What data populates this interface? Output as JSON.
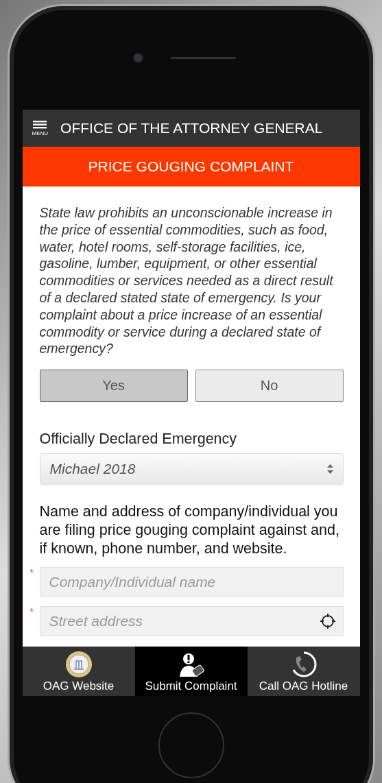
{
  "header": {
    "menu_label": "MENU",
    "title": "OFFICE OF THE ATTORNEY GENERAL"
  },
  "banner": {
    "title": "PRICE GOUGING COMPLAINT"
  },
  "intro": "State law prohibits an unconscionable increase in the price of essential commodities, such as food, water, hotel rooms, self-storage facilities, ice, gasoline, lumber, equipment, or other essential commodities or services needed as a direct result of a declared stated state of emergency. Is your complaint about a price increase of an essential commodity or service during a declared state of emergency?",
  "answers": [
    {
      "label": "Yes",
      "selected": true
    },
    {
      "label": "No",
      "selected": false
    }
  ],
  "emergency": {
    "label": "Officially Declared Emergency",
    "value": "Michael 2018"
  },
  "company_prompt": "Name and address of company/individual you are filing price gouging complaint against and, if known, phone number, and website.",
  "fields": [
    {
      "placeholder": "Company/Individual name",
      "required_mark": "*",
      "kind": "text"
    },
    {
      "placeholder": "Street address",
      "required_mark": "*",
      "kind": "location"
    }
  ],
  "tabs": [
    {
      "label": "OAG Website",
      "kind": "seal",
      "selected": false
    },
    {
      "label": "Submit Complaint",
      "kind": "complaint",
      "selected": true
    },
    {
      "label": "Call OAG Hotline",
      "kind": "phone",
      "selected": false
    }
  ]
}
